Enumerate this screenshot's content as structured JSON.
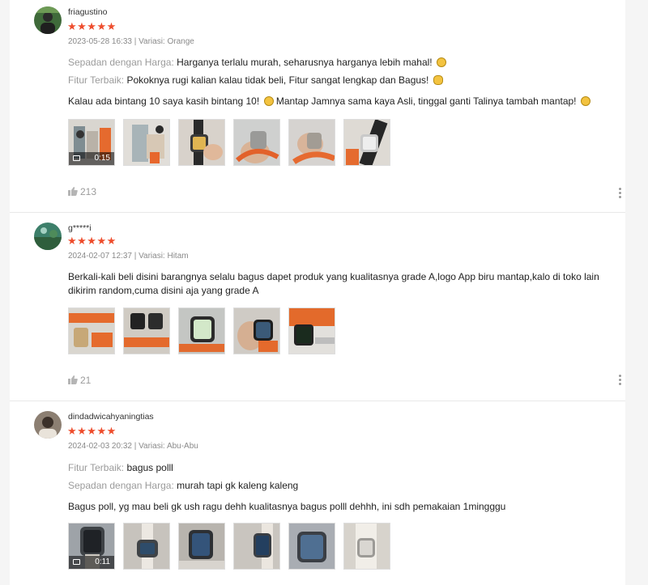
{
  "reviews": [
    {
      "username": "friagustino",
      "stars": "★★★★★",
      "meta": "2023-05-28 16:33 | Variasi: Orange",
      "fields": [
        {
          "label": "Sepadan dengan Harga:",
          "value": " Harganya terlalu murah, seharusnya harganya lebih mahal!"
        },
        {
          "label": "Fitur Terbaik:",
          "value": " Pokoknya rugi kalian kalau tidak beli, Fitur sangat lengkap dan Bagus!"
        }
      ],
      "body": "Kalau ada bintang 10 saya kasih bintang 10! ",
      "body2": " Mantap Jamnya sama kaya Asli, tinggal ganti Talinya tambah mantap! ",
      "video_duration": "0:15",
      "likes": "213"
    },
    {
      "username": "g*****i",
      "stars": "★★★★★",
      "meta": "2024-02-07 12:37 | Variasi: Hitam",
      "body": "Berkali-kali beli disini barangnya selalu bagus dapet produk yang kualitasnya grade A,logo App biru mantap,kalo di toko lain dikirim random,cuma disini aja yang grade A",
      "likes": "21"
    },
    {
      "username": "dindadwicahyaningtias",
      "stars": "★★★★★",
      "meta": "2024-02-03 20:32 | Variasi: Abu-Abu",
      "fields": [
        {
          "label": "Fitur Terbaik:",
          "value": " bagus polll"
        },
        {
          "label": "Sepadan dengan Harga:",
          "value": " murah tapi gk kaleng kaleng"
        }
      ],
      "body": "Bagus poll, yg mau beli gk ush ragu dehh kualitasnya bagus polll dehhh, ini sdh pemakaian 1mingggu",
      "video_duration": "0:11"
    }
  ],
  "icons": {
    "like": "thumbs-up-icon",
    "more": "more-vertical-icon",
    "video": "video-camera-icon"
  },
  "colors": {
    "star": "#ee4d2d",
    "label": "#9b9b9b",
    "watch_band_orange": "#e9652c"
  }
}
